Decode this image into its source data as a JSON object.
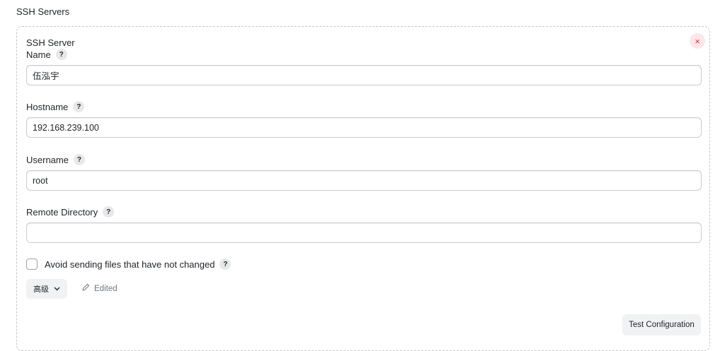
{
  "section": {
    "title": "SSH Servers"
  },
  "server": {
    "title": "SSH Server",
    "close_icon": "×",
    "fields": {
      "name": {
        "label": "Name",
        "value": "伍泓宇"
      },
      "hostname": {
        "label": "Hostname",
        "value": "192.168.239.100"
      },
      "username": {
        "label": "Username",
        "value": "root"
      },
      "remote_directory": {
        "label": "Remote Directory",
        "value": ""
      }
    },
    "help_glyph": "?",
    "avoid_sending": {
      "label": "Avoid sending files that have not changed",
      "checked": false
    },
    "advanced_button": {
      "label": "高级",
      "icon": "chevron-down-icon"
    },
    "edited_label": "Edited",
    "test_button": "Test Configuration"
  },
  "colors": {
    "close_bg": "#fde7ea",
    "close_fg": "#d6334a",
    "border": "#c7ccd1",
    "muted": "#6f7680"
  }
}
